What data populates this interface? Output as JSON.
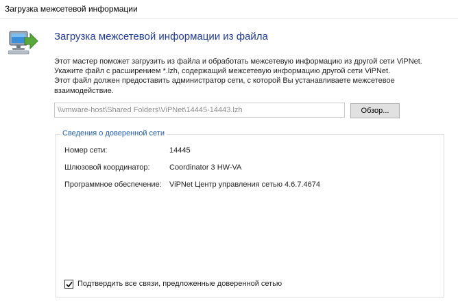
{
  "window": {
    "title": "Загрузка межсетевой информации"
  },
  "header": {
    "icon": "computer-import-icon",
    "title": "Загрузка межсетевой информации из файла"
  },
  "description": {
    "line1": "Этот мастер поможет загрузить из файла и обработать межсетевую информацию из другой сети ViPNet.",
    "line2": "Укажите файл с расширением *.lzh, содержащий межсетевую информацию другой сети ViPNet.",
    "line3": "Этот файл должен предоставить администратор сети, с которой Вы устанавливаете межсетевое",
    "line4": "взаимодействие."
  },
  "file": {
    "path": "\\\\vmware-host\\Shared Folders\\ViPNet\\14445-14443.lzh",
    "browse_label": "Обзор..."
  },
  "trusted_network": {
    "legend": "Сведения о доверенной сети",
    "network_number_label": "Номер сети:",
    "network_number_value": "14445",
    "gateway_label": "Шлюзовой координатор:",
    "gateway_value": "Coordinator 3 HW-VA",
    "software_label": "Программное обеспечение:",
    "software_value": "ViPNet Центр управления сетью 4.6.7.4674"
  },
  "confirm": {
    "label": "Подтвердить все связи, предложенные доверенной сетью",
    "checked": true
  },
  "colors": {
    "title_blue": "#1f3a93",
    "legend_blue": "#1f5ea8",
    "arrow_green": "#5aa83c"
  }
}
